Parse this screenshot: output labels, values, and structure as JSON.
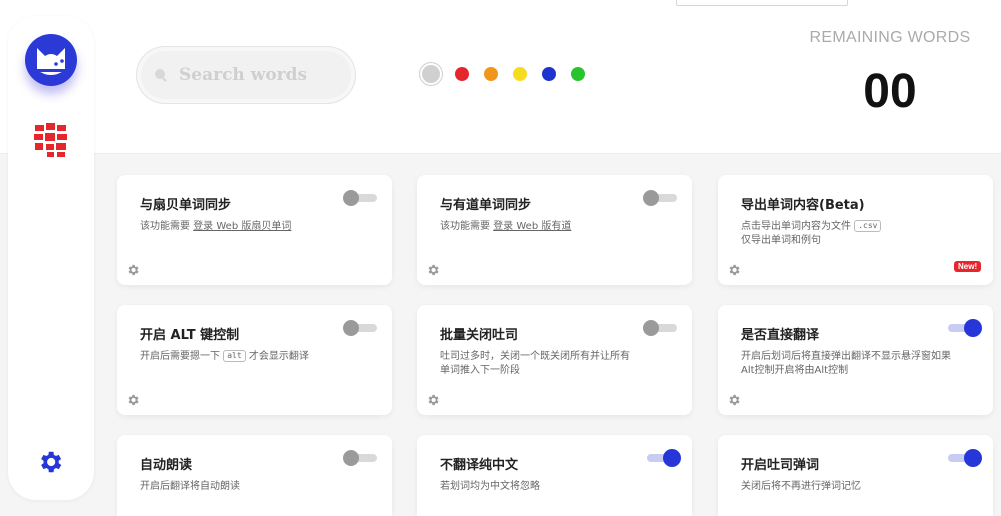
{
  "search": {
    "placeholder": "Search words"
  },
  "colors": {
    "accent": "#2636d8",
    "filters": [
      "#d0d0d0",
      "#e5262d",
      "#f0961a",
      "#f5dc1f",
      "#1f33cf",
      "#27c42d"
    ]
  },
  "remaining": {
    "label": "REMAINING WORDS",
    "count": "00"
  },
  "sidebar": {
    "items": [
      {
        "icon": "cat-avatar-icon"
      },
      {
        "icon": "word-grid-icon"
      },
      {
        "icon": "gear-icon"
      }
    ]
  },
  "cards": [
    {
      "title": "与扇贝单词同步",
      "desc_prefix": "该功能需要",
      "desc_link": "登录 Web 版扇贝单词",
      "toggle": "off"
    },
    {
      "title": "与有道单词同步",
      "desc_prefix": "该功能需要",
      "desc_link": "登录 Web 版有道",
      "toggle": "off"
    },
    {
      "title": "导出单词内容(Beta)",
      "desc_line1": "点击导出单词内容为文件",
      "desc_code": ".csv",
      "desc_line2": "仅导出单词和例句",
      "badge": "New!"
    },
    {
      "title": "开启 ALT 键控制",
      "desc_prefix": "开启后需要摁一下",
      "desc_code": "alt",
      "desc_suffix": "才会显示翻译",
      "toggle": "off"
    },
    {
      "title": "批量关闭吐司",
      "desc": "吐司过多时，关闭一个既关闭所有并让所有单词推入下一阶段",
      "toggle": "off"
    },
    {
      "title": "是否直接翻译",
      "desc": "开启后划词后将直接弹出翻译不显示悬浮窗如果Alt控制开启将由Alt控制",
      "toggle": "on"
    },
    {
      "title": "自动朗读",
      "desc": "开启后翻译将自动朗读",
      "toggle": "off"
    },
    {
      "title": "不翻译纯中文",
      "desc": "若划词均为中文将忽略",
      "toggle": "on"
    },
    {
      "title": "开启吐司弹词",
      "desc": "关闭后将不再进行弹词记忆",
      "toggle": "on"
    }
  ]
}
